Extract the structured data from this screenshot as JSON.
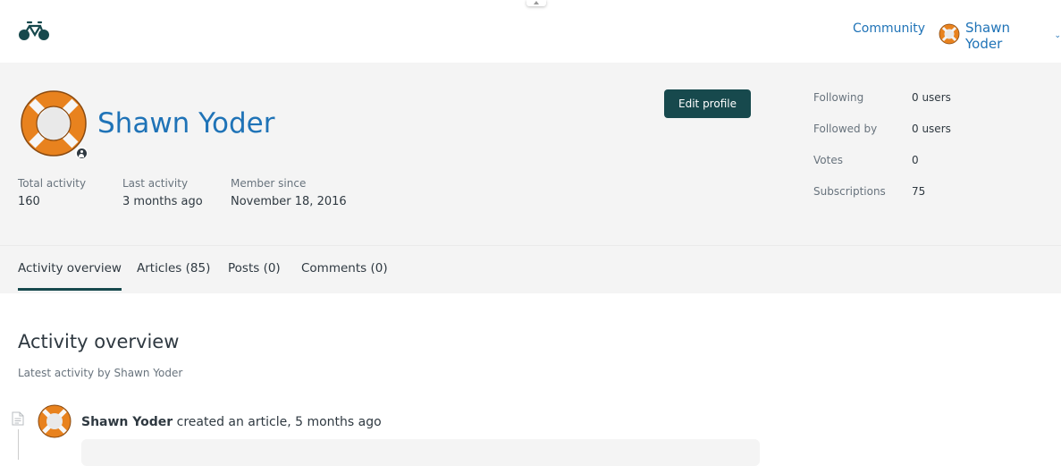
{
  "header": {
    "logo_icon": "bicycle-icon",
    "community_label": "Community",
    "user_name": "Shawn Yoder",
    "user_avatar_icon": "lifebuoy-icon",
    "chevron_icon": "chevron-down-icon"
  },
  "profile": {
    "name": "Shawn Yoder",
    "avatar_icon": "lifebuoy-icon",
    "badge_icon": "user-badge-icon",
    "edit_label": "Edit profile",
    "activity": [
      {
        "label": "Total activity",
        "value": "160"
      },
      {
        "label": "Last activity",
        "value": "3 months ago"
      },
      {
        "label": "Member since",
        "value": "November 18, 2016"
      }
    ],
    "stats": [
      {
        "label": "Following",
        "value": "0 users"
      },
      {
        "label": "Followed by",
        "value": "0 users"
      },
      {
        "label": "Votes",
        "value": "0"
      },
      {
        "label": "Subscriptions",
        "value": "75"
      }
    ]
  },
  "tabs": [
    {
      "label": "Activity overview",
      "active": true
    },
    {
      "label": "Articles (85)",
      "active": false
    },
    {
      "label": "Posts (0)",
      "active": false
    },
    {
      "label": "Comments (0)",
      "active": false
    }
  ],
  "overview": {
    "title": "Activity overview",
    "subtitle": "Latest activity by Shawn Yoder",
    "item": {
      "type_icon": "document-icon",
      "author": "Shawn Yoder",
      "action": " created an article, 5 months ago"
    }
  },
  "colors": {
    "link": "#1f73b7",
    "primary_button": "#17494d",
    "band": "#f4f4f4",
    "avatar_orange": "#e8821e"
  }
}
